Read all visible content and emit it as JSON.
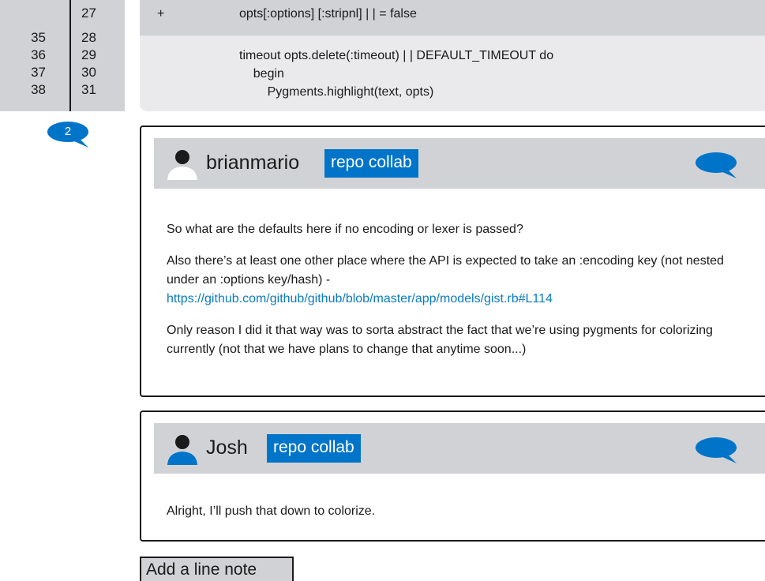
{
  "diff": {
    "line_numbers": [
      {
        "old": "",
        "new": "27"
      },
      {
        "old": "35",
        "new": "28"
      },
      {
        "old": "36",
        "new": "29"
      },
      {
        "old": "37",
        "new": "30"
      },
      {
        "old": "38",
        "new": "31"
      }
    ],
    "added_line": {
      "sign": "+",
      "code": "opts[:options] [:stripnl] | | = false"
    },
    "context_lines": [
      "timeout opts.delete(:timeout) | | DEFAULT_TIMEOUT do",
      "    begin",
      "        Pygments.highlight(text, opts)"
    ]
  },
  "comment_count": "2",
  "comments": [
    {
      "author": "brianmario",
      "badge": "repo collab",
      "paragraphs": [
        "So what are the defaults here if no encoding or lexer is passed?",
        "Also there’s at least one other place where the API is expected to take an :encoding key (not nested under an :options key/hash) -",
        "Only reason I did it that way was to sorta abstract the fact that we’re using pygments for colorizing currently (not that we have plans to change that anytime soon...)"
      ],
      "link": "https://github.com/github/github/blob/master/app/models/gist.rb#L114"
    },
    {
      "author": "Josh",
      "badge": "repo collab",
      "paragraphs": [
        "Alright, I’ll push that down to colorize."
      ]
    }
  ],
  "add_note_label": "Add a line note",
  "colors": {
    "accent": "#0074c8",
    "link": "#0a7bc1",
    "gray_bar": "#d1d2d5",
    "light_gray": "#eaeaec"
  },
  "icons": {
    "comment_count": "speech-bubble-icon",
    "reply": "speech-bubble-icon",
    "avatar": "user-silhouette-icon"
  }
}
